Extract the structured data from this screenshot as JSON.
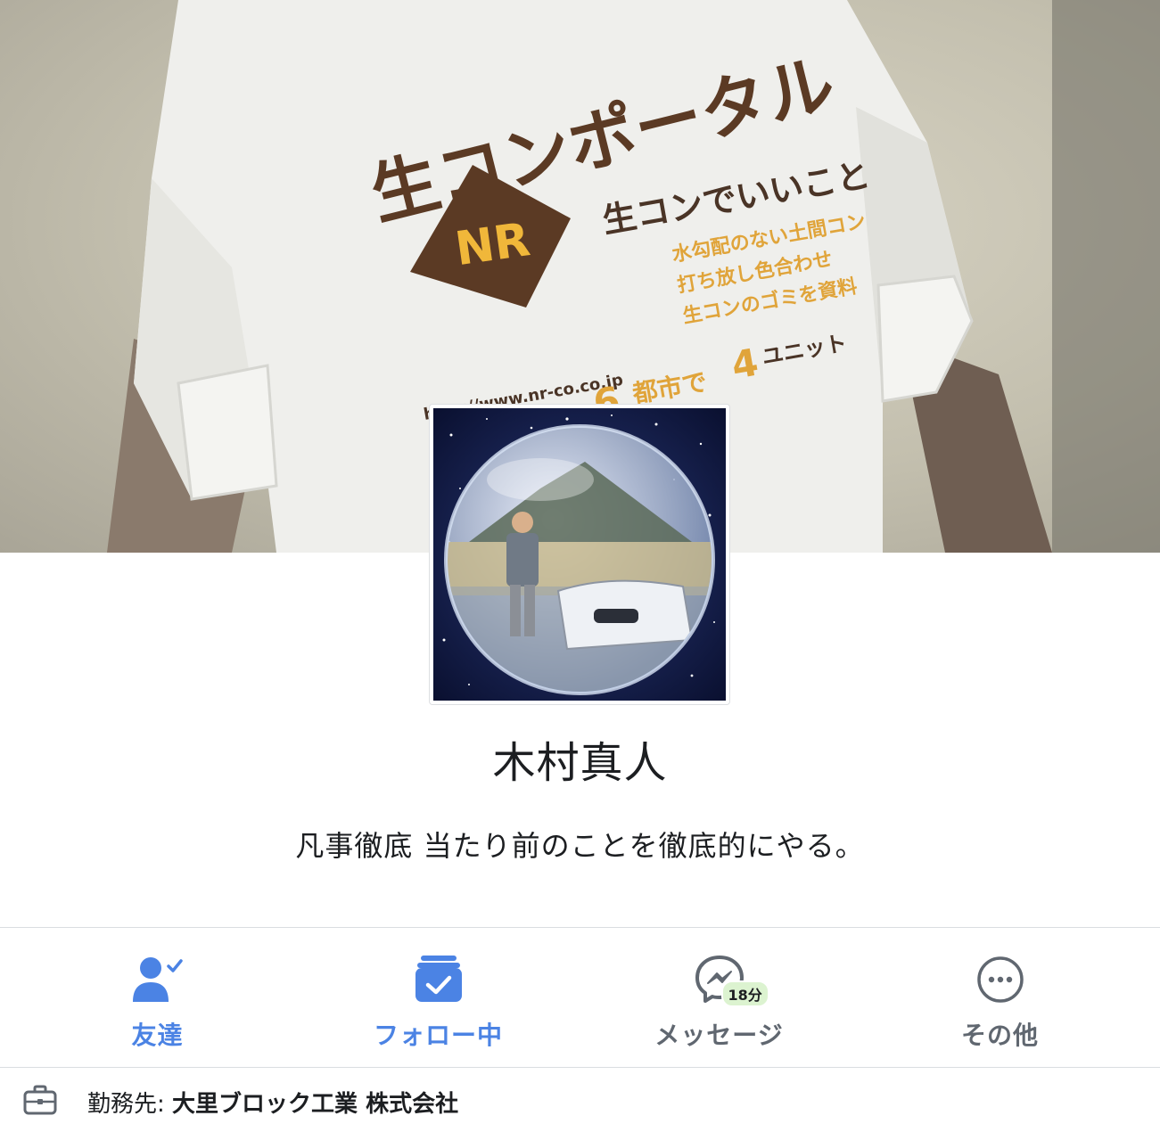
{
  "cover": {
    "shirt_print": {
      "headline": "生コンポータル",
      "logo": "NR",
      "tagline": "生コンでいいこと",
      "bullet_1": "水勾配のない土間コン",
      "bullet_2": "打ち放し色合わせ",
      "bullet_3": "生コンのゴミを資料",
      "url": "http://www.nr-co.co.jp",
      "footer_big1": "6",
      "footer_mid": "都市で",
      "footer_big2": "4",
      "footer_end": "ユニット"
    }
  },
  "profile": {
    "name": "木村真人",
    "bio": "凡事徹底 当たり前のことを徹底的にやる。"
  },
  "actions": {
    "friends": {
      "label": "友達",
      "icon": "friend-check-icon"
    },
    "following": {
      "label": "フォロー中",
      "icon": "following-check-icon"
    },
    "message": {
      "label": "メッセージ",
      "icon": "messenger-icon",
      "badge": "18分"
    },
    "more": {
      "label": "その他",
      "icon": "more-dots-icon"
    }
  },
  "work": {
    "prefix": "勤務先: ",
    "company": "大里ブロック工業 株式会社",
    "icon": "briefcase-icon"
  },
  "colors": {
    "accent_blue": "#4b83e4",
    "gray_text": "#606770",
    "badge_green": "#dcf3d0",
    "shirt_brown": "#5b3a24",
    "shirt_yellow": "#f0b73a"
  }
}
